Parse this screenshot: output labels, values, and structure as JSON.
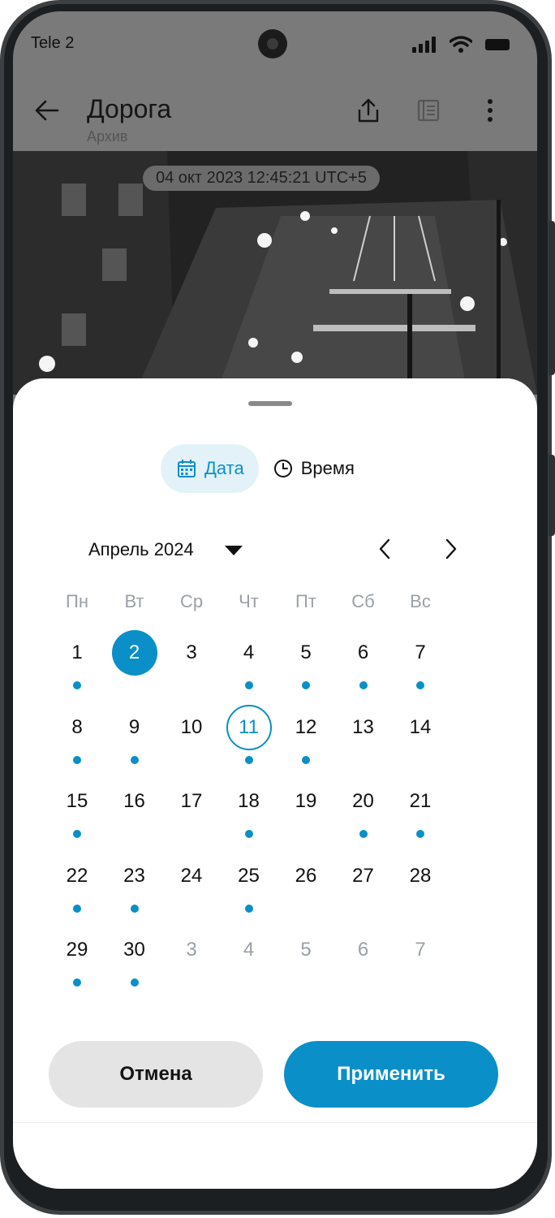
{
  "status_bar": {
    "carrier": "Tele 2"
  },
  "app_bar": {
    "title": "Дорога",
    "subtitle": "Архив"
  },
  "video": {
    "timestamp": "04 окт 2023 12:45:21 UTC+5"
  },
  "tabs": {
    "date": "Дата",
    "time": "Время",
    "active": "date"
  },
  "calendar": {
    "month_label": "Апрель 2024",
    "weekdays": [
      "Пн",
      "Вт",
      "Ср",
      "Чт",
      "Пт",
      "Сб",
      "Вс"
    ],
    "weeks": [
      [
        {
          "d": "1",
          "dot": true
        },
        {
          "d": "2",
          "dot": false,
          "selected": true
        },
        {
          "d": "3",
          "dot": false
        },
        {
          "d": "4",
          "dot": true
        },
        {
          "d": "5",
          "dot": true
        },
        {
          "d": "6",
          "dot": true
        },
        {
          "d": "7",
          "dot": true
        }
      ],
      [
        {
          "d": "8",
          "dot": true
        },
        {
          "d": "9",
          "dot": true
        },
        {
          "d": "10",
          "dot": false
        },
        {
          "d": "11",
          "dot": true,
          "today": true
        },
        {
          "d": "12",
          "dot": true
        },
        {
          "d": "13",
          "dot": false
        },
        {
          "d": "14",
          "dot": false
        }
      ],
      [
        {
          "d": "15",
          "dot": true
        },
        {
          "d": "16",
          "dot": false
        },
        {
          "d": "17",
          "dot": false
        },
        {
          "d": "18",
          "dot": true
        },
        {
          "d": "19",
          "dot": false
        },
        {
          "d": "20",
          "dot": true
        },
        {
          "d": "21",
          "dot": true
        }
      ],
      [
        {
          "d": "22",
          "dot": true
        },
        {
          "d": "23",
          "dot": true
        },
        {
          "d": "24",
          "dot": false
        },
        {
          "d": "25",
          "dot": true
        },
        {
          "d": "26",
          "dot": false
        },
        {
          "d": "27",
          "dot": false
        },
        {
          "d": "28",
          "dot": false
        }
      ],
      [
        {
          "d": "29",
          "dot": true
        },
        {
          "d": "30",
          "dot": true
        },
        {
          "d": "3",
          "dot": false,
          "muted": true
        },
        {
          "d": "4",
          "dot": false,
          "muted": true
        },
        {
          "d": "5",
          "dot": false,
          "muted": true
        },
        {
          "d": "6",
          "dot": false,
          "muted": true
        },
        {
          "d": "7",
          "dot": false,
          "muted": true
        }
      ]
    ]
  },
  "actions": {
    "cancel": "Отмена",
    "apply": "Применить"
  },
  "colors": {
    "accent": "#0a8fc8",
    "accent_light": "#e3f2f8",
    "muted": "#9aa0a6"
  }
}
